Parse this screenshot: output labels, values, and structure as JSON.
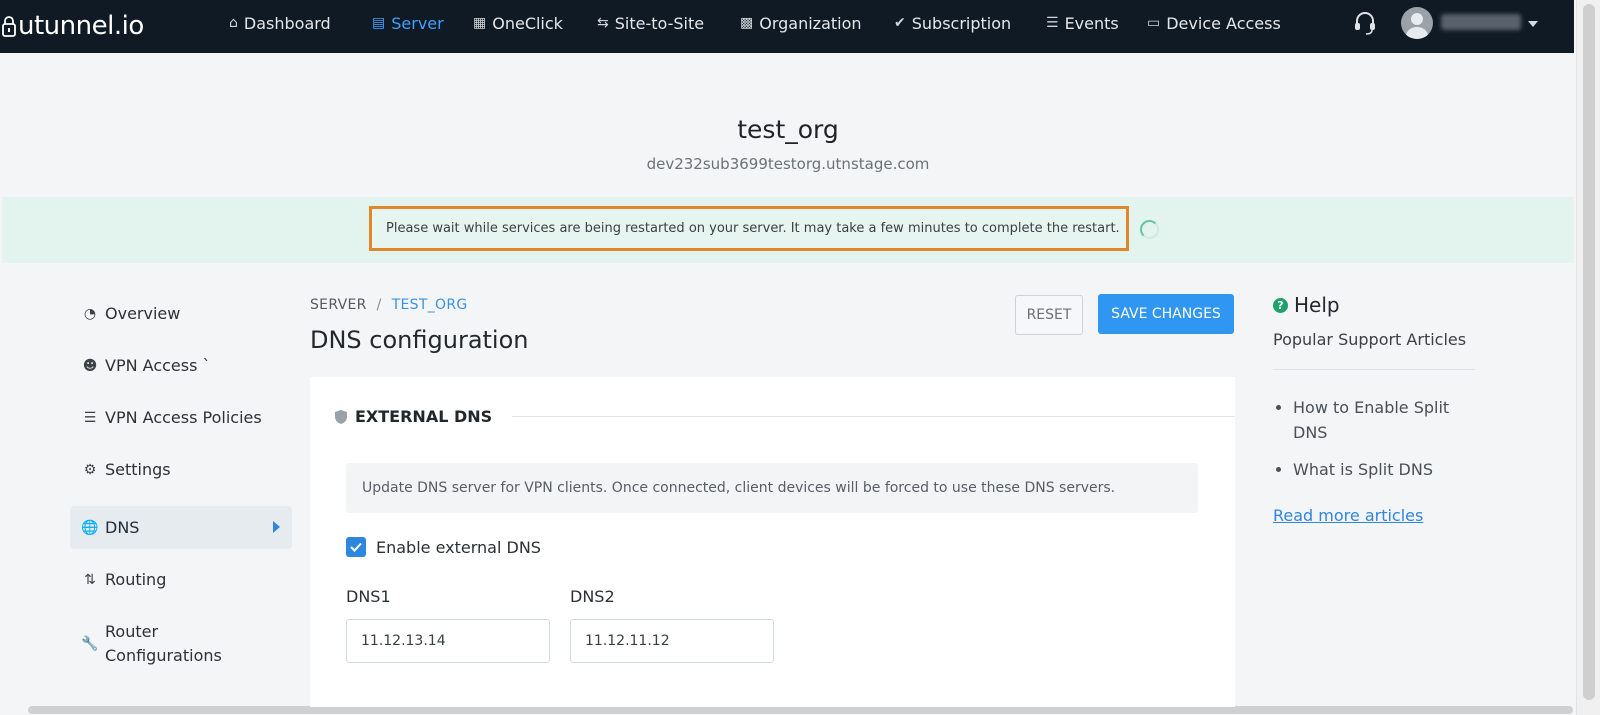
{
  "brand": {
    "name": "utunnel.io"
  },
  "nav": {
    "items": [
      {
        "label": "Dashboard",
        "icon": "home-icon",
        "active": false
      },
      {
        "label": "Server",
        "icon": "server-icon",
        "active": true
      },
      {
        "label": "OneClick",
        "icon": "grid-icon",
        "active": false
      },
      {
        "label": "Site-to-Site",
        "icon": "link-icon",
        "active": false
      },
      {
        "label": "Organization",
        "icon": "building-icon",
        "active": false
      },
      {
        "label": "Subscription",
        "icon": "check-circle-icon",
        "active": false
      },
      {
        "label": "Events",
        "icon": "list-icon",
        "active": false
      },
      {
        "label": "Device Access",
        "icon": "monitor-icon",
        "active": false
      }
    ],
    "accent_color": "#3fa0ff",
    "background_color": "#0f1a24"
  },
  "org": {
    "title": "test_org",
    "domain": "dev232sub3699testorg.utnstage.com"
  },
  "notice": {
    "message": "Please wait while services are being restarted on your server. It may take a few minutes to complete the restart.",
    "highlight_color": "#e0862b"
  },
  "sidebar": {
    "items": [
      {
        "label": "Overview",
        "icon": "pie-chart-icon"
      },
      {
        "label": "VPN Access `",
        "icon": "user-icon"
      },
      {
        "label": "VPN Access Policies",
        "icon": "policy-list-icon"
      },
      {
        "label": "Settings",
        "icon": "gear-icon"
      },
      {
        "label": "DNS",
        "icon": "globe-icon",
        "active": true
      },
      {
        "label": "Routing",
        "icon": "routing-icon"
      },
      {
        "label": "Router Configurations",
        "icon": "wrench-icon"
      }
    ]
  },
  "breadcrumb": {
    "root": "SERVER",
    "current": "TEST_ORG"
  },
  "page": {
    "title": "DNS configuration"
  },
  "actions": {
    "reset_label": "RESET",
    "save_label": "SAVE CHANGES"
  },
  "external_dns": {
    "section_title": "EXTERNAL DNS",
    "info": "Update DNS server for VPN clients. Once connected, client devices will be forced to use these DNS servers.",
    "enable_label": "Enable external DNS",
    "enabled": true,
    "dns1_label": "DNS1",
    "dns1_value": "11.12.13.14",
    "dns2_label": "DNS2",
    "dns2_value": "11.12.11.12"
  },
  "help": {
    "title": "Help",
    "subtitle": "Popular Support Articles",
    "articles": [
      "How to Enable Split DNS",
      "What is Split DNS"
    ],
    "more_label": "Read more articles"
  }
}
